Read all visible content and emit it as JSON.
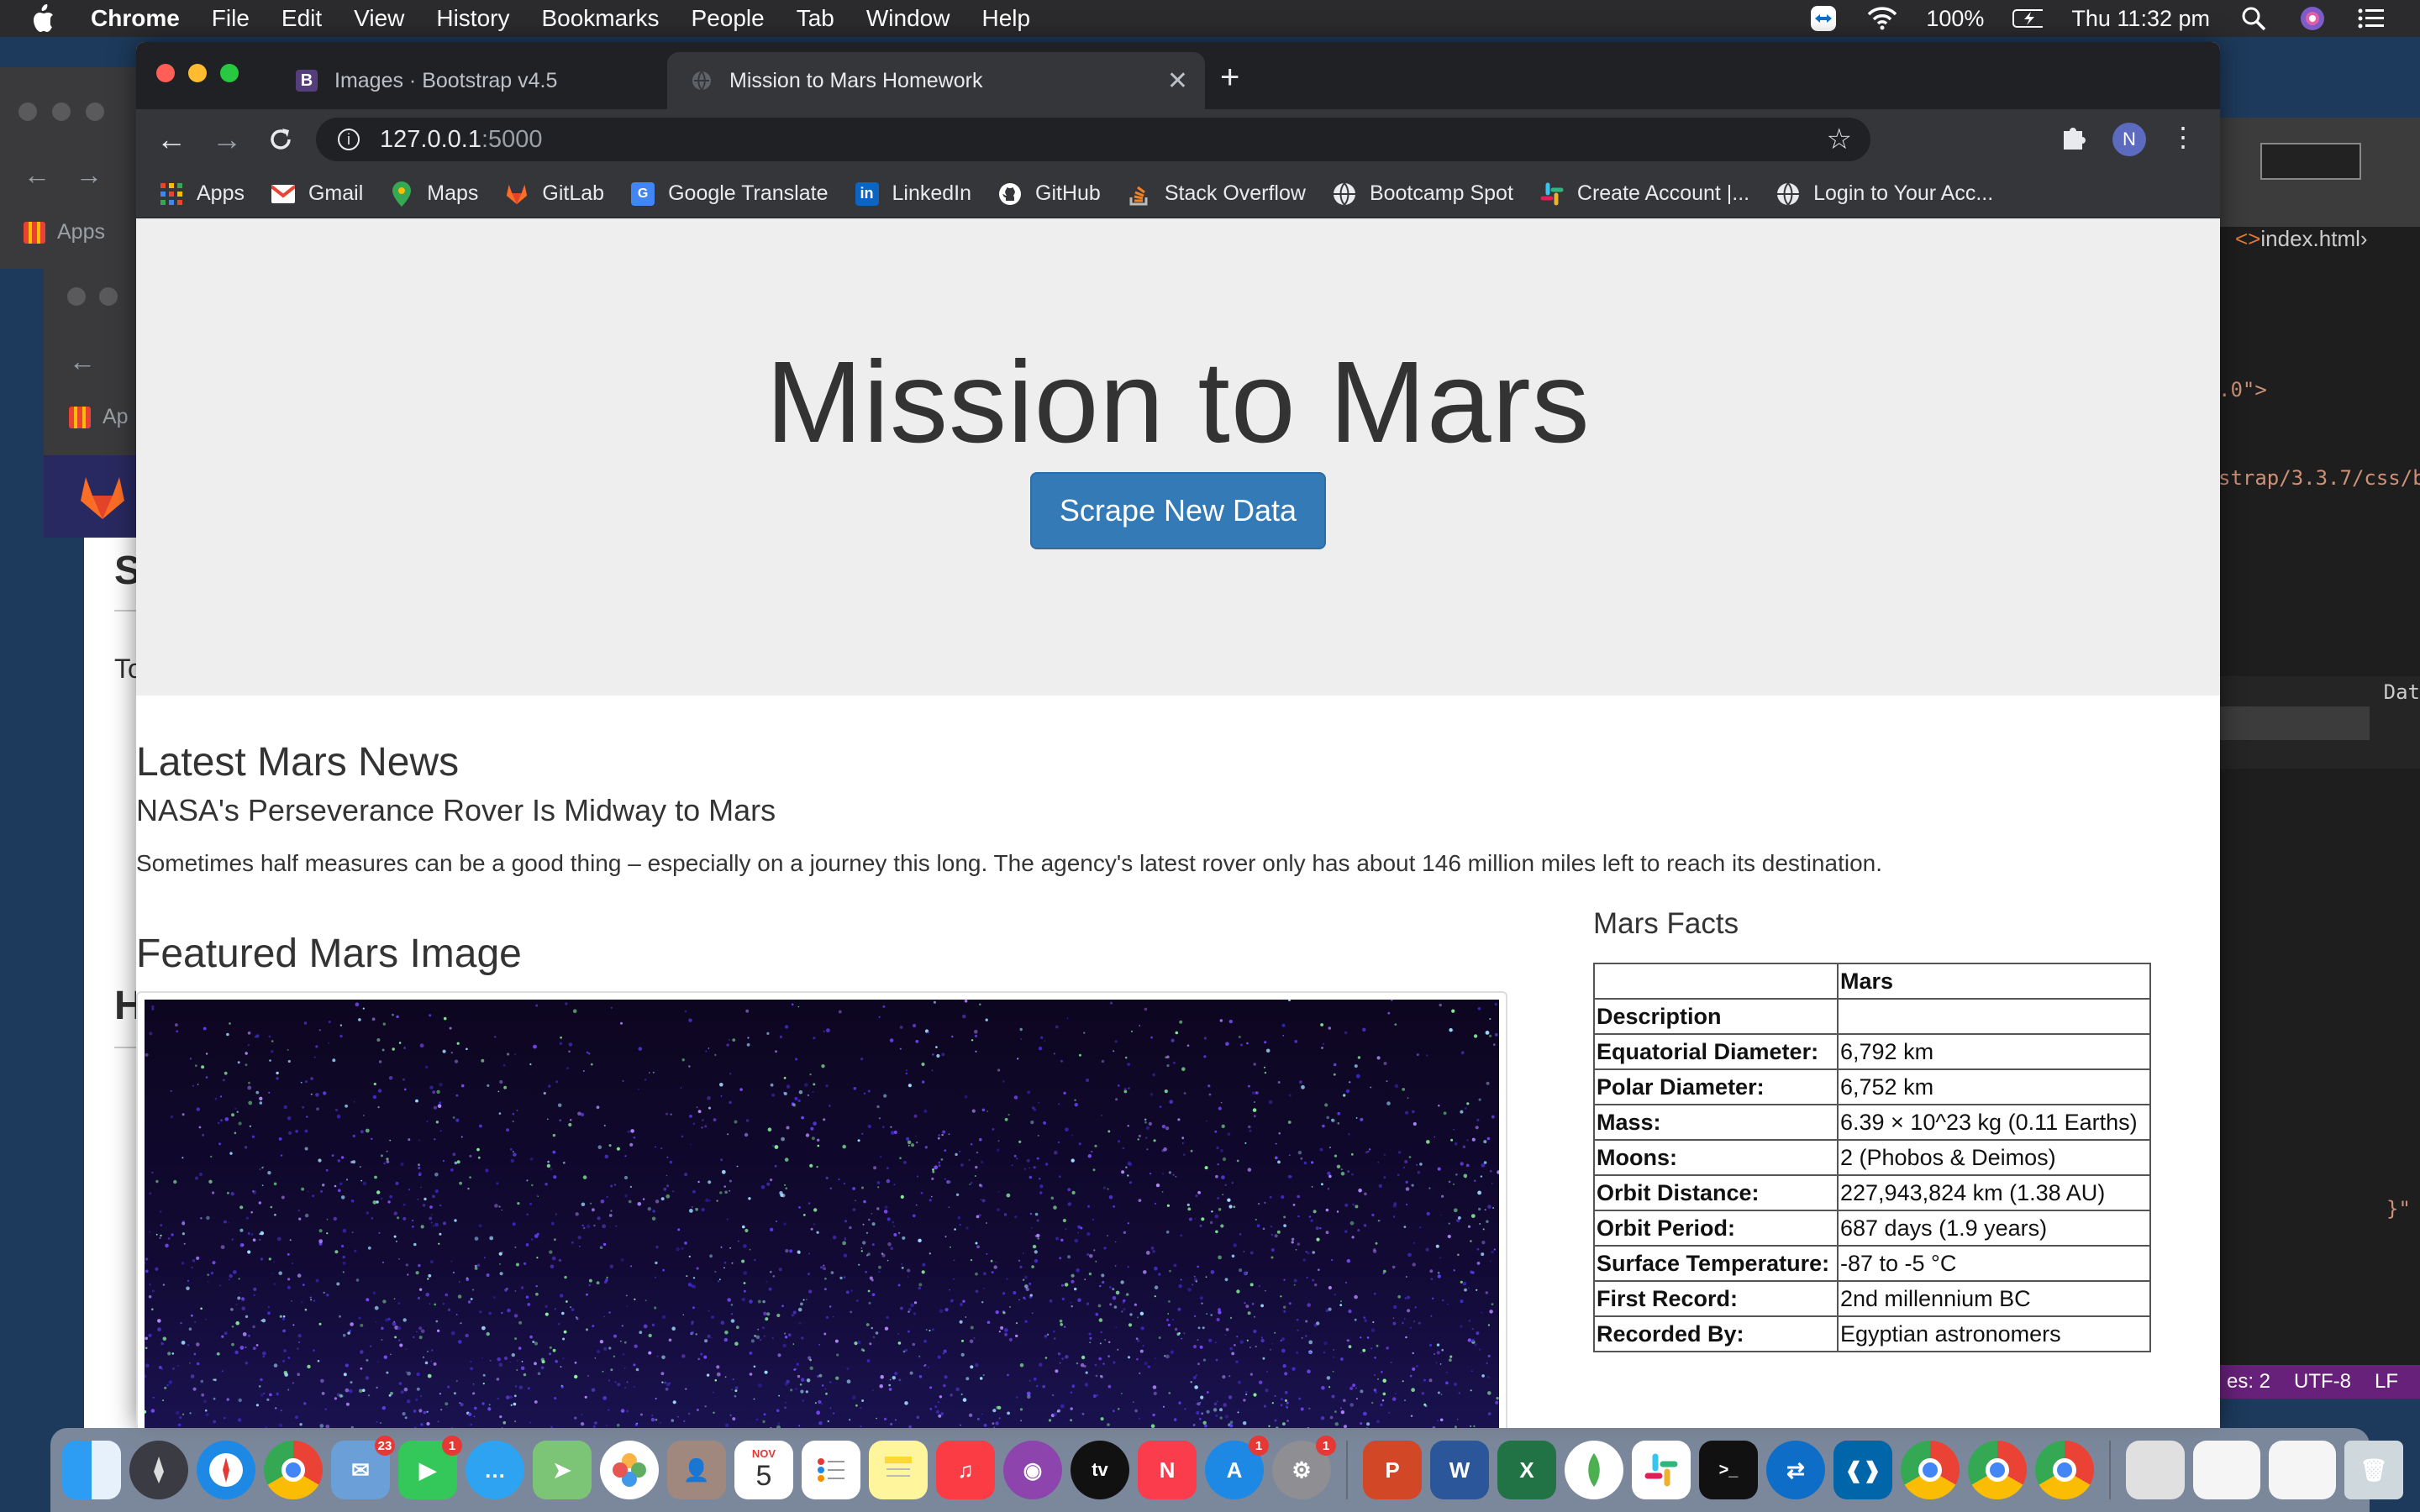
{
  "menubar": {
    "app_name": "Chrome",
    "menus": [
      "File",
      "Edit",
      "View",
      "History",
      "Bookmarks",
      "People",
      "Tab",
      "Window",
      "Help"
    ],
    "battery": "100%",
    "clock": "Thu 11:32 pm"
  },
  "browser": {
    "tabs": [
      {
        "title": "Images · Bootstrap v4.5",
        "favicon": "B"
      },
      {
        "title": "Mission to Mars Homework",
        "favicon": "globe"
      }
    ],
    "url_host": "127.0.0.1",
    "url_port": ":5000",
    "profile_initial": "N",
    "bookmarks": [
      {
        "label": "Apps",
        "icon": "apps-grid-icon"
      },
      {
        "label": "Gmail",
        "icon": "gmail-icon"
      },
      {
        "label": "Maps",
        "icon": "maps-pin-icon"
      },
      {
        "label": "GitLab",
        "icon": "gitlab-icon"
      },
      {
        "label": "Google Translate",
        "icon": "translate-icon"
      },
      {
        "label": "LinkedIn",
        "icon": "linkedin-icon"
      },
      {
        "label": "GitHub",
        "icon": "github-icon"
      },
      {
        "label": "Stack Overflow",
        "icon": "stackoverflow-icon"
      },
      {
        "label": "Bootcamp Spot",
        "icon": "globe-icon"
      },
      {
        "label": "Create Account |...",
        "icon": "slack-icon"
      },
      {
        "label": "Login to Your Acc...",
        "icon": "globe-icon"
      }
    ]
  },
  "page": {
    "title": "Mission to Mars",
    "scrape_button": "Scrape New Data",
    "news_heading": "Latest Mars News",
    "news_title": "NASA's Perseverance Rover Is Midway to Mars",
    "news_paragraph": "Sometimes half measures can be a good thing – especially on a journey this long. The agency's latest rover only has about 146 million miles left to reach its destination.",
    "image_heading": "Featured Mars Image",
    "facts_heading": "Mars Facts",
    "facts_table": {
      "header": [
        "",
        "Mars"
      ],
      "rows": [
        [
          "Description",
          ""
        ],
        [
          "Equatorial Diameter:",
          "6,792 km"
        ],
        [
          "Polar Diameter:",
          "6,752 km"
        ],
        [
          "Mass:",
          "6.39 × 10^23 kg (0.11 Earths)"
        ],
        [
          "Moons:",
          "2 (Phobos & Deimos)"
        ],
        [
          "Orbit Distance:",
          "227,943,824 km (1.38 AU)"
        ],
        [
          "Orbit Period:",
          "687 days (1.9 years)"
        ],
        [
          "Surface Temperature:",
          "-87 to -5 °C"
        ],
        [
          "First Record:",
          "2nd millennium BC"
        ],
        [
          "Recorded By:",
          "Egyptian astronomers"
        ]
      ]
    }
  },
  "background_editor": {
    "tab_label": "index.html",
    "code_line_1": ".0\">",
    "code_line_2": "strap/3.3.7/css/b",
    "code_line_3": "Dat",
    "code_line_4": "}\"",
    "status_spaces": "es: 2",
    "status_encoding": "UTF-8",
    "status_eol": "LF"
  },
  "background_window": {
    "apps_label": "Apps",
    "apps_label_2": "Ap",
    "partial_text_1": "S",
    "partial_text_2": "To",
    "partial_text_3": "H"
  },
  "dock": {
    "calendar_month": "NOV",
    "calendar_day": "5",
    "badges": {
      "mail": "23",
      "facetime": "1",
      "appstore": "1",
      "settings": "1"
    }
  }
}
